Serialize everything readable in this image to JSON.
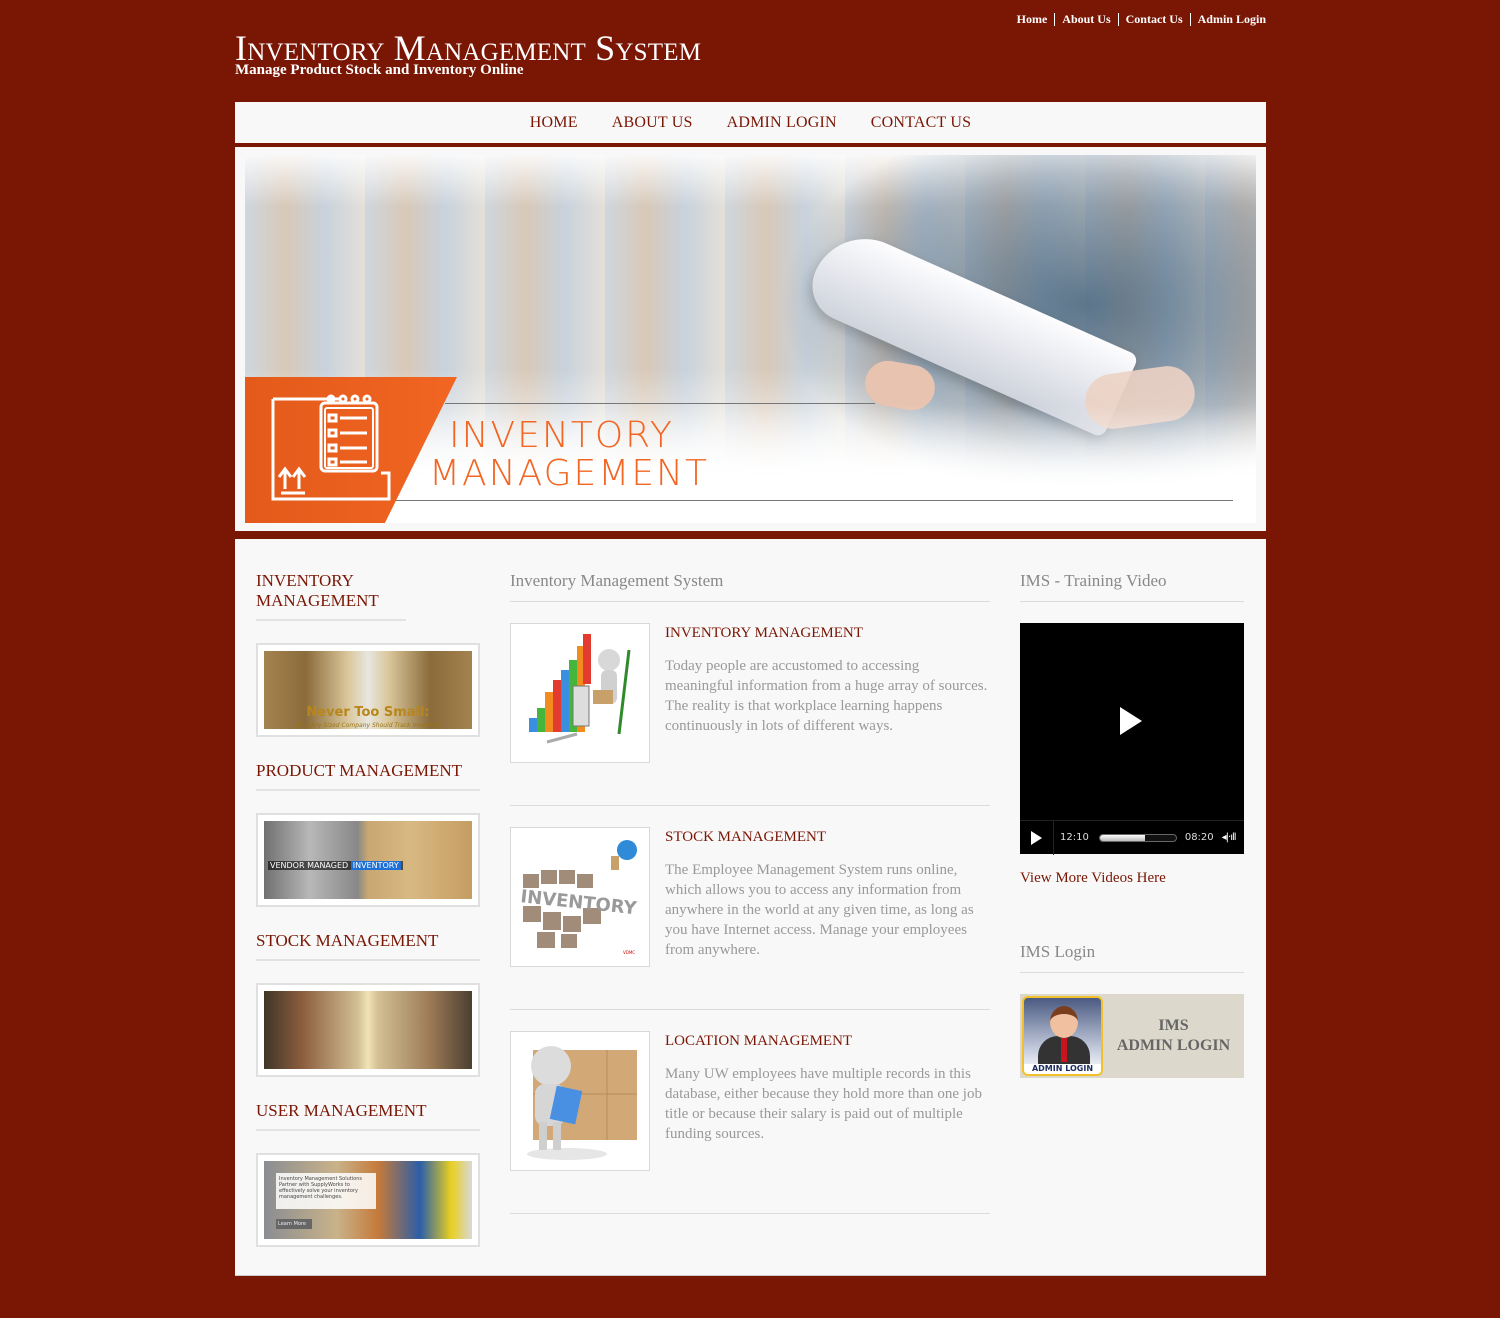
{
  "header": {
    "title": "Inventory Management System",
    "subtitle": "Manage Product Stock and Inventory Online",
    "top_links": [
      "Home",
      "About Us",
      "Contact Us",
      "Admin Login"
    ]
  },
  "nav": {
    "items": [
      "HOME",
      "ABOUT US",
      "ADMIN LOGIN",
      "CONTACT US"
    ]
  },
  "hero": {
    "line1": "INVENTORY",
    "line2": "MANAGEMENT",
    "accent_color": "#f26522"
  },
  "sidebar": {
    "sections": [
      {
        "title": "INVENTORY MANAGEMENT",
        "image_caption": "Never Too Small:",
        "image_subcaption": "Why Any-Sized Company Should Track Inventory"
      },
      {
        "title": "PRODUCT MANAGEMENT",
        "image_caption": "VENDOR MANAGED",
        "image_caption_highlight": "INVENTORY"
      },
      {
        "title": "STOCK MANAGEMENT"
      },
      {
        "title": "USER MANAGEMENT",
        "image_caption": "Inventory Management Solutions",
        "image_subcaption": "Partner with SupplyWorks to effectively solve your inventory management challenges.",
        "image_button": "Learn More"
      }
    ]
  },
  "main": {
    "heading": "Inventory Management System",
    "features": [
      {
        "title": "INVENTORY MANAGEMENT",
        "text": "Today people are accustomed to accessing meaningful information from a huge array of sources. The reality is that workplace learning happens continuously in lots of different ways."
      },
      {
        "title": "STOCK MANAGEMENT",
        "text": "The Employee Management System runs online, which allows you to access any information from anywhere in the world at any given time, as long as you have Internet access. Manage your employees from anywhere."
      },
      {
        "title": "LOCATION MANAGEMENT",
        "text": "Many UW employees have multiple records in this database, either because they hold more than one job title or because their salary is paid out of multiple funding sources."
      }
    ]
  },
  "right": {
    "video_heading": "IMS - Training Video",
    "video": {
      "elapsed": "12:10",
      "remaining": "08:20",
      "progress_fraction": 0.6
    },
    "view_more": "View More Videos Here",
    "login_heading": "IMS Login",
    "login_badge": "ADMIN LOGIN",
    "login_line1": "IMS",
    "login_line2": "ADMIN LOGIN"
  },
  "colors": {
    "brand": "#7a1604",
    "accent": "#f26522"
  }
}
